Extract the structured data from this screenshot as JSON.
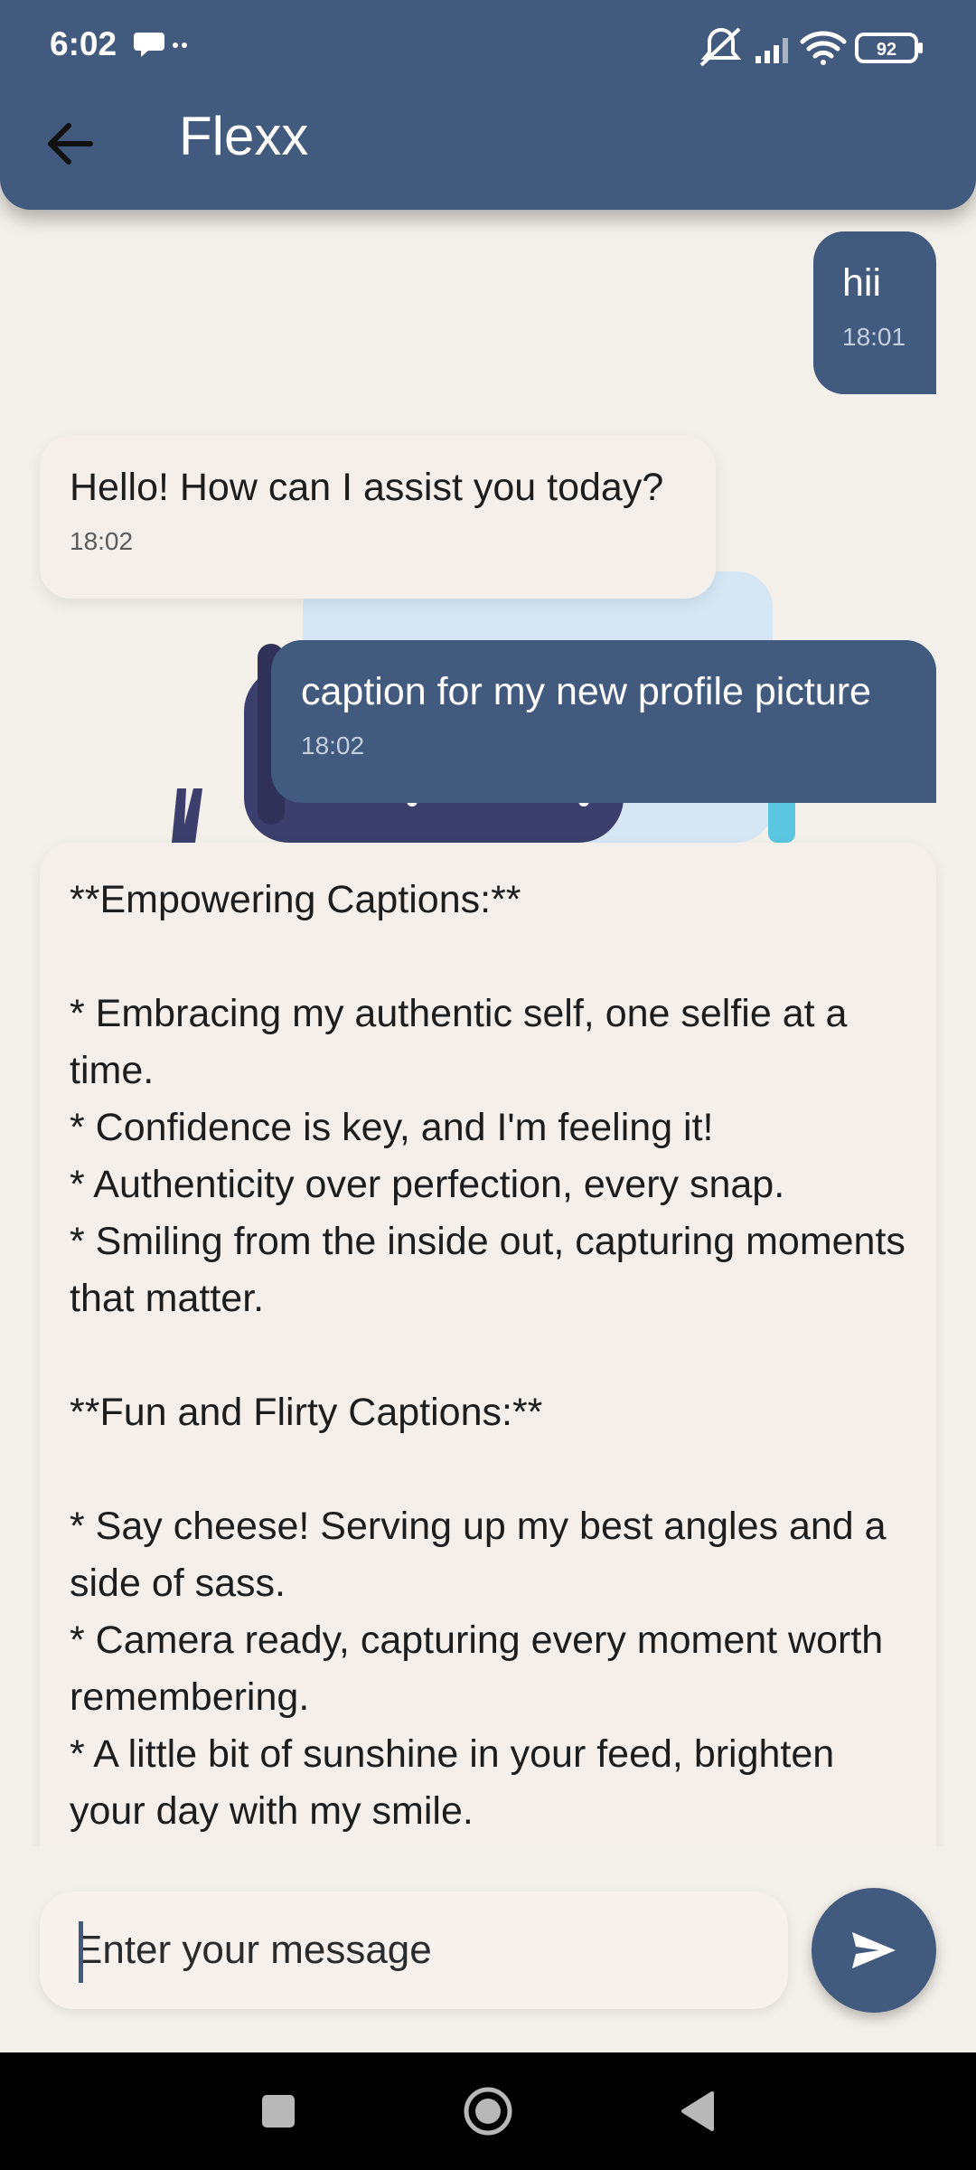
{
  "status_bar": {
    "time": "6:02",
    "battery": "92"
  },
  "app_bar": {
    "title": "Flexx"
  },
  "messages": [
    {
      "sender": "user",
      "text": "hii",
      "time": "18:01"
    },
    {
      "sender": "bot",
      "text": "Hello! How can I assist you today?",
      "time": "18:02"
    },
    {
      "sender": "user",
      "text": "caption for my new profile picture",
      "time": "18:02"
    },
    {
      "sender": "bot",
      "text": "**Empowering Captions:**\n\n* Embracing my authentic self, one selfie at a time.\n* Confidence is key, and I'm feeling it!\n* Authenticity over perfection, every snap.\n* Smiling from the inside out, capturing moments that matter.\n\n**Fun and Flirty Captions:**\n\n* Say cheese! Serving up my best angles and a side of sass.\n* Camera ready, capturing every moment worth remembering.\n* A little bit of sunshine in your feed, brighten your day with my smile."
    }
  ],
  "composer": {
    "placeholder": "Enter your message"
  },
  "colors": {
    "primary": "#415a7d",
    "background": "#f3efea",
    "bubble_received": "#f4efea"
  },
  "icons": {
    "back": "arrow-left-icon",
    "send": "send-icon",
    "nav_recents": "square-icon",
    "nav_home": "circle-icon",
    "nav_back": "triangle-back-icon"
  }
}
